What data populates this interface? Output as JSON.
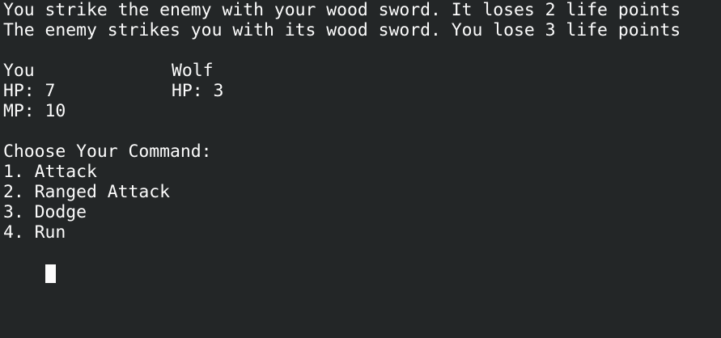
{
  "log": [
    "You strike the enemy with your wood sword. It loses 2 life points",
    "The enemy strikes you with its wood sword. You lose 3 life points"
  ],
  "player": {
    "name": "You",
    "hp": "HP: 7",
    "mp": "MP: 10"
  },
  "enemy": {
    "name": "Wolf",
    "hp": "HP: 3"
  },
  "prompt": "Choose Your Command:",
  "commands": [
    "1. Attack",
    "2. Ranged Attack",
    "3. Dodge",
    "4. Run"
  ],
  "colors": {
    "background": "#232627",
    "foreground": "#fcfcfc"
  },
  "cursor_icon": "block-cursor"
}
